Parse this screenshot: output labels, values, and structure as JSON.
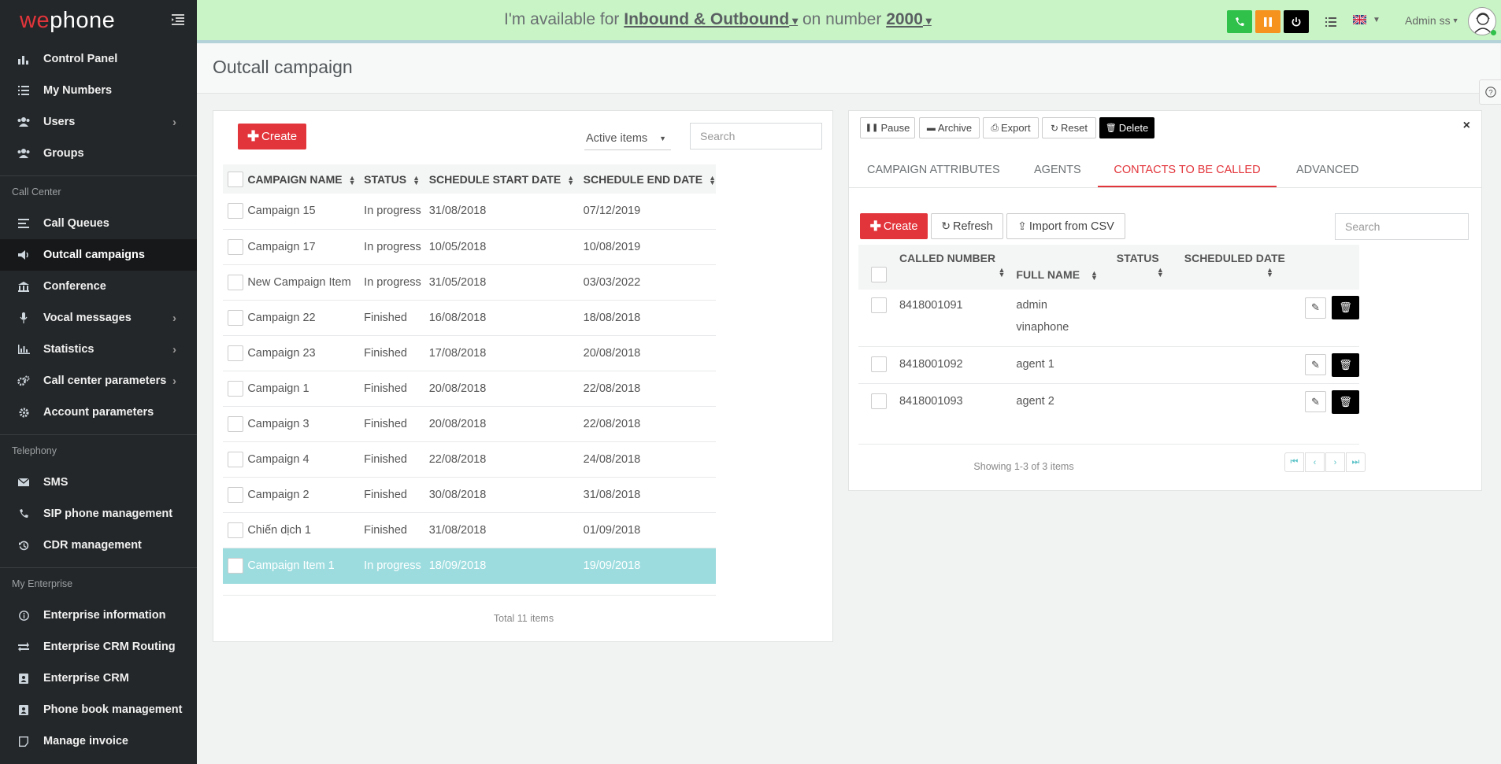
{
  "app": {
    "logo_pre": "we",
    "logo_post": "phone"
  },
  "sidebar": {
    "items_main": [
      {
        "label": "Control Panel",
        "icon": "bar-chart-icon",
        "glyph": "▮"
      },
      {
        "label": "My Numbers",
        "icon": "list-icon",
        "glyph": "☰"
      },
      {
        "label": "Users",
        "icon": "users-icon",
        "glyph": "●"
      },
      {
        "label": "Groups",
        "icon": "groups-icon",
        "glyph": "●"
      }
    ],
    "section_call_center": "Call Center",
    "items_call_center": [
      {
        "label": "Call Queues",
        "icon": "queue-icon"
      },
      {
        "label": "Outcall campaigns",
        "icon": "megaphone-icon"
      },
      {
        "label": "Conference",
        "icon": "bank-icon"
      },
      {
        "label": "Vocal messages",
        "icon": "microphone-icon"
      },
      {
        "label": "Statistics",
        "icon": "statistics-icon"
      },
      {
        "label": "Call center parameters",
        "icon": "cogs-icon"
      },
      {
        "label": "Account parameters",
        "icon": "gear-icon"
      }
    ],
    "section_telephony": "Telephony",
    "items_telephony": [
      {
        "label": "SMS",
        "icon": "envelope-icon"
      },
      {
        "label": "SIP phone management",
        "icon": "phone-icon"
      },
      {
        "label": "CDR management",
        "icon": "history-icon"
      }
    ],
    "section_enterprise": "My Enterprise",
    "items_enterprise": [
      {
        "label": "Enterprise information",
        "icon": "info-icon"
      },
      {
        "label": "Enterprise CRM Routing",
        "icon": "exchange-icon"
      },
      {
        "label": "Enterprise CRM",
        "icon": "crm-icon"
      },
      {
        "label": "Phone book management",
        "icon": "phonebook-icon"
      },
      {
        "label": "Manage invoice",
        "icon": "invoice-icon"
      }
    ]
  },
  "topbar": {
    "avail_prefix": "I'm available for",
    "avail_mode": "Inbound & Outbound",
    "avail_middle": "on number",
    "avail_number": "2000",
    "user_name": "Admin ss",
    "colors": {
      "call": "#2fc14a",
      "pause": "#f6921e",
      "power": "#000000"
    }
  },
  "page": {
    "title": "Outcall campaign"
  },
  "campaigns": {
    "create_label": "Create",
    "filter_selected": "Active items",
    "search_placeholder": "Search",
    "columns": [
      "CAMPAIGN NAME",
      "STATUS",
      "SCHEDULE START DATE",
      "SCHEDULE END DATE"
    ],
    "rows": [
      {
        "name": "Campaign 15",
        "status": "In progress",
        "start": "31/08/2018",
        "end": "07/12/2019"
      },
      {
        "name": "Campaign 17",
        "status": "In progress",
        "start": "10/05/2018",
        "end": "10/08/2019"
      },
      {
        "name": "New Campaign Item",
        "status": "In progress",
        "start": "31/05/2018",
        "end": "03/03/2022"
      },
      {
        "name": "Campaign 22",
        "status": "Finished",
        "start": "16/08/2018",
        "end": "18/08/2018"
      },
      {
        "name": "Campaign 23",
        "status": "Finished",
        "start": "17/08/2018",
        "end": "20/08/2018"
      },
      {
        "name": "Campaign 1",
        "status": "Finished",
        "start": "20/08/2018",
        "end": "22/08/2018"
      },
      {
        "name": "Campaign 3",
        "status": "Finished",
        "start": "20/08/2018",
        "end": "22/08/2018"
      },
      {
        "name": "Campaign 4",
        "status": "Finished",
        "start": "22/08/2018",
        "end": "24/08/2018"
      },
      {
        "name": "Campaign 2",
        "status": "Finished",
        "start": "30/08/2018",
        "end": "31/08/2018"
      },
      {
        "name": "Chiến dịch 1",
        "status": "Finished",
        "start": "31/08/2018",
        "end": "01/09/2018"
      },
      {
        "name": "Campaign Item 1",
        "status": "In progress",
        "start": "18/09/2018",
        "end": "19/09/2018",
        "selected": true
      }
    ],
    "total": "Total 11 items"
  },
  "detail": {
    "toolbar": {
      "pause": "Pause",
      "archive": "Archive",
      "export": "Export",
      "reset": "Reset",
      "delete": "Delete"
    },
    "tabs": [
      "CAMPAIGN ATTRIBUTES",
      "AGENTS",
      "CONTACTS TO BE CALLED",
      "ADVANCED"
    ],
    "active_tab": "CONTACTS TO BE CALLED",
    "create_label": "Create",
    "refresh_label": "Refresh",
    "import_label": "Import from CSV",
    "search_placeholder": "Search",
    "columns": [
      "CALLED NUMBER",
      "FULL NAME",
      "STATUS",
      "SCHEDULED DATE"
    ],
    "rows": [
      {
        "number": "8418001091",
        "name_line1": "admin",
        "name_line2": "vinaphone"
      },
      {
        "number": "8418001092",
        "name_line1": "agent 1",
        "name_line2": ""
      },
      {
        "number": "8418001093",
        "name_line1": "agent 2",
        "name_line2": ""
      }
    ],
    "showing": "Showing 1-3 of 3 items"
  }
}
